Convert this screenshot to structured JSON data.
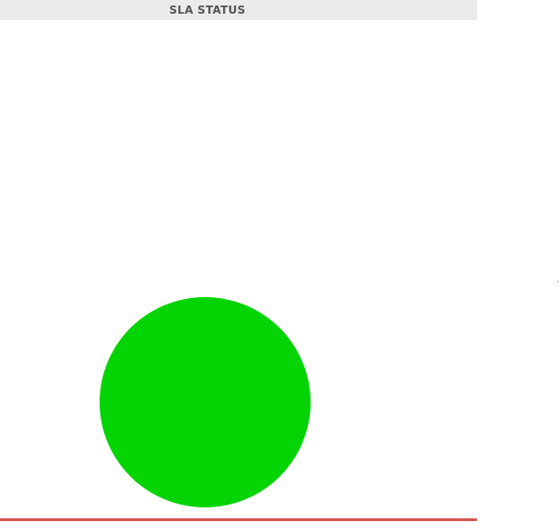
{
  "panel": {
    "title": "SLA STATUS",
    "status_color": "#04d404",
    "rule_color": "#d9534f",
    "edge_mark": "·"
  }
}
